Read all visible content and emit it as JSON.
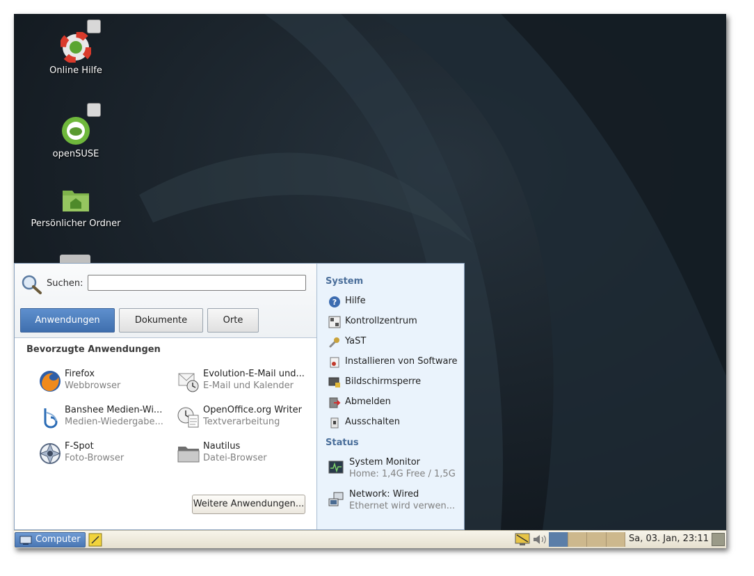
{
  "desktop": {
    "icons": [
      {
        "label": "Online Hilfe",
        "icon": "help-lifebuoy-icon"
      },
      {
        "label": "openSUSE",
        "icon": "opensuse-logo-icon"
      },
      {
        "label": "Persönlicher Ordner",
        "icon": "home-folder-icon"
      }
    ]
  },
  "menu": {
    "search_label": "Suchen:",
    "search_value": "",
    "tabs": [
      {
        "label": "Anwendungen",
        "active": true
      },
      {
        "label": "Dokumente",
        "active": false
      },
      {
        "label": "Orte",
        "active": false
      }
    ],
    "favorites_title": "Bevorzugte Anwendungen",
    "apps": [
      {
        "name": "Firefox",
        "desc": "Webbrowser",
        "icon": "firefox-icon"
      },
      {
        "name": "Evolution-E-Mail und...",
        "desc": "E-Mail und Kalender",
        "icon": "evolution-mail-icon"
      },
      {
        "name": "Banshee Medien-Wi...",
        "desc": "Medien-Wiedergabe...",
        "icon": "banshee-icon"
      },
      {
        "name": "OpenOffice.org Writer",
        "desc": "Textverarbeitung",
        "icon": "writer-icon"
      },
      {
        "name": "F-Spot",
        "desc": "Foto-Browser",
        "icon": "fspot-icon"
      },
      {
        "name": "Nautilus",
        "desc": "Datei-Browser",
        "icon": "folder-icon"
      }
    ],
    "more_label": "Weitere Anwendungen...",
    "system_title": "System",
    "system_items": [
      {
        "label": "Hilfe",
        "icon": "help-icon"
      },
      {
        "label": "Kontrollzentrum",
        "icon": "control-center-icon"
      },
      {
        "label": "YaST",
        "icon": "wrench-icon"
      },
      {
        "label": "Installieren von Software",
        "icon": "software-install-icon"
      },
      {
        "label": "Bildschirmsperre",
        "icon": "screen-lock-icon"
      },
      {
        "label": "Abmelden",
        "icon": "logout-icon"
      },
      {
        "label": "Ausschalten",
        "icon": "shutdown-icon"
      }
    ],
    "status_title": "Status",
    "status_items": [
      {
        "label": "System Monitor",
        "detail": "Home: 1,4G Free / 1,5G",
        "icon": "system-monitor-icon"
      },
      {
        "label": "Network: Wired",
        "detail": "Ethernet wird verwen...",
        "icon": "network-icon"
      }
    ]
  },
  "panel": {
    "computer_label": "Computer",
    "clock": "Sa, 03. Jan, 23:11",
    "workspaces": 4,
    "current_workspace": 1
  },
  "colors": {
    "accent": "#4a77b4",
    "menu_right_bg": "#eaf3fc",
    "panel_bg": "#ece7d8",
    "wallpaper": "#161d24"
  }
}
